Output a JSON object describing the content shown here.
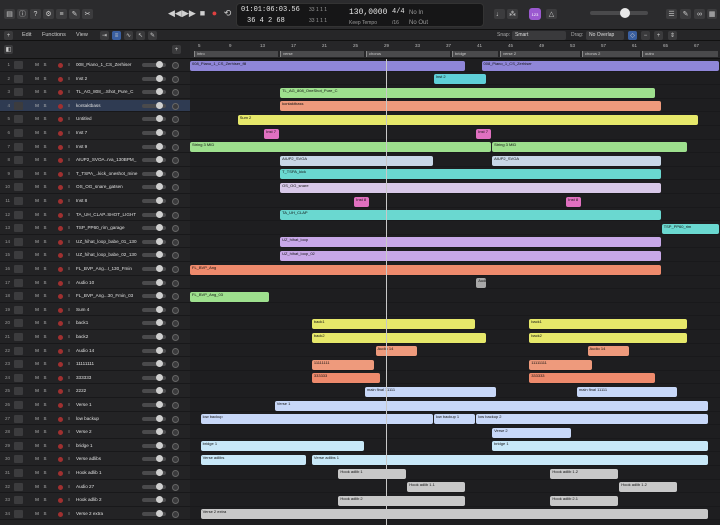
{
  "lcd": {
    "time": "01:01:06:03.56",
    "time_sub": "33 1 1   1",
    "bars": "36 4 2   68",
    "bars_sub": "33 1 1   1",
    "tempo": "130,0000",
    "tempo_sub": "Keep Tempo",
    "signature": "4/4",
    "signature_sub": "/16",
    "in": "No In",
    "out": "No Out"
  },
  "badge": "123",
  "toolbar": {
    "edit": "Edit",
    "functions": "Functions",
    "view": "View",
    "snap_label": "Snap:",
    "snap_value": "Smart",
    "drag_label": "Drag:",
    "drag_value": "No Overlap"
  },
  "ruler": {
    "bars": [
      "5",
      "9",
      "13",
      "17",
      "21",
      "25",
      "29",
      "33",
      "37",
      "41",
      "45",
      "49",
      "53",
      "57",
      "61",
      "65",
      "67"
    ],
    "markers": [
      "intro",
      "verse",
      "chorus",
      "verse 2",
      "bridge",
      "chorus 2",
      "outro"
    ]
  },
  "tracks": [
    {
      "num": "1",
      "name": "008_Piano_1_CS_Zerhiser"
    },
    {
      "num": "2",
      "name": "Inst 2"
    },
    {
      "num": "3",
      "name": "TL_AG_808_..Shot_Pure_C"
    },
    {
      "num": "4",
      "name": "kontaktbass"
    },
    {
      "num": "5",
      "name": "Untitled"
    },
    {
      "num": "6",
      "name": "Inst 7"
    },
    {
      "num": "7",
      "name": "Inst 9"
    },
    {
      "num": "8",
      "name": "AIUP2_SVOA..rva_130BPM_"
    },
    {
      "num": "9",
      "name": "T_TSPA_..kick_oneshot_mine"
    },
    {
      "num": "10",
      "name": "OS_OG_snare_gatsen"
    },
    {
      "num": "11",
      "name": "Inst 8"
    },
    {
      "num": "12",
      "name": "TA_UH_CLAP..SHOT_LIGHT"
    },
    {
      "num": "13",
      "name": "TSP_PP60_rim_garage"
    },
    {
      "num": "14",
      "name": "UZ_hihat_loop_babe_01_130"
    },
    {
      "num": "15",
      "name": "UZ_hihat_loop_babe_02_130"
    },
    {
      "num": "16",
      "name": "FL_BVP_Ang...I_130_Fmin"
    },
    {
      "num": "17",
      "name": "Audio 10"
    },
    {
      "num": "18",
      "name": "FL_BVP_Ang...30_Fmin_03"
    },
    {
      "num": "19",
      "name": "Sum 4"
    },
    {
      "num": "20",
      "name": "back1"
    },
    {
      "num": "21",
      "name": "back2"
    },
    {
      "num": "22",
      "name": "Audio 14"
    },
    {
      "num": "23",
      "name": "11111111"
    },
    {
      "num": "24",
      "name": "333333"
    },
    {
      "num": "25",
      "name": "2222"
    },
    {
      "num": "26",
      "name": "Verse 1"
    },
    {
      "num": "27",
      "name": "low backup"
    },
    {
      "num": "28",
      "name": "Verse 2"
    },
    {
      "num": "29",
      "name": "bridge 1"
    },
    {
      "num": "30",
      "name": "Verse adlibs"
    },
    {
      "num": "31",
      "name": "Hook adlib 1"
    },
    {
      "num": "32",
      "name": "Audio 27"
    },
    {
      "num": "33",
      "name": "Hook adlib 2"
    },
    {
      "num": "34",
      "name": "Verse 2 extra"
    }
  ],
  "regions": [
    {
      "lane": 0,
      "start": 0.0,
      "end": 0.52,
      "color": "#8f86d8",
      "label": "008_Piano_1_CS_Zerhiser_fill"
    },
    {
      "lane": 0,
      "start": 0.55,
      "end": 1.0,
      "color": "#8f86d8",
      "label": "008_Piano_1_CS_Zerhiser"
    },
    {
      "lane": 1,
      "start": 0.46,
      "end": 0.56,
      "color": "#5fd0d8",
      "label": "Inst 2"
    },
    {
      "lane": 1,
      "start": 0.56,
      "end": 0.56,
      "color": "#5fd0d8",
      "label": ""
    },
    {
      "lane": 2,
      "start": 0.17,
      "end": 0.88,
      "color": "#9ee08e",
      "label": "TL_AG_808_OneShot_Pure_C"
    },
    {
      "lane": 3,
      "start": 0.17,
      "end": 0.89,
      "color": "#ee9a7c",
      "label": "kontaktbass"
    },
    {
      "lane": 4,
      "start": 0.09,
      "end": 0.96,
      "color": "#e6e86a",
      "label": "Sum 2"
    },
    {
      "lane": 5,
      "start": 0.14,
      "end": 0.17,
      "color": "#e070c0",
      "label": "Inst 7"
    },
    {
      "lane": 5,
      "start": 0.54,
      "end": 0.57,
      "color": "#e070c0",
      "label": "Inst 7"
    },
    {
      "lane": 6,
      "start": 0.0,
      "end": 0.57,
      "color": "#9ee08e",
      "label": "String 3 MID"
    },
    {
      "lane": 6,
      "start": 0.57,
      "end": 0.94,
      "color": "#9ee08e",
      "label": "String 3 MID"
    },
    {
      "lane": 7,
      "start": 0.17,
      "end": 0.46,
      "color": "#c8d8e8",
      "label": "AIUP2_SVOA"
    },
    {
      "lane": 7,
      "start": 0.57,
      "end": 0.89,
      "color": "#c8d8e8",
      "label": "AIUP2_SVOA"
    },
    {
      "lane": 8,
      "start": 0.17,
      "end": 0.89,
      "color": "#6ad8d0",
      "label": "T_TSPA_kick"
    },
    {
      "lane": 9,
      "start": 0.17,
      "end": 0.89,
      "color": "#d8c8e8",
      "label": "OS_OG_snare"
    },
    {
      "lane": 10,
      "start": 0.31,
      "end": 0.34,
      "color": "#e070c0",
      "label": "Inst 8"
    },
    {
      "lane": 10,
      "start": 0.71,
      "end": 0.74,
      "color": "#e070c0",
      "label": "Inst 8"
    },
    {
      "lane": 11,
      "start": 0.17,
      "end": 0.89,
      "color": "#6ad8d0",
      "label": "TA_UH_CLAP"
    },
    {
      "lane": 12,
      "start": 0.89,
      "end": 1.0,
      "color": "#6ad8d0",
      "label": "TSP_PP60_rim"
    },
    {
      "lane": 13,
      "start": 0.17,
      "end": 0.89,
      "color": "#c8a8e8",
      "label": "UZ_hihat_loop"
    },
    {
      "lane": 14,
      "start": 0.17,
      "end": 0.89,
      "color": "#c8a8e8",
      "label": "UZ_hihat_loop_02"
    },
    {
      "lane": 15,
      "start": 0.0,
      "end": 0.89,
      "color": "#ee8a6c",
      "label": "FL_BVP_Ang"
    },
    {
      "lane": 16,
      "start": 0.54,
      "end": 0.56,
      "color": "#a8a8a8",
      "label": "Audio 10"
    },
    {
      "lane": 17,
      "start": 0.0,
      "end": 0.15,
      "color": "#9ee08e",
      "label": "FL_BVP_Ang_03"
    },
    {
      "lane": 19,
      "start": 0.23,
      "end": 0.54,
      "color": "#e6e86a",
      "label": "back1"
    },
    {
      "lane": 19,
      "start": 0.64,
      "end": 0.94,
      "color": "#e6e86a",
      "label": "back1"
    },
    {
      "lane": 20,
      "start": 0.23,
      "end": 0.56,
      "color": "#e6e86a",
      "label": "back2"
    },
    {
      "lane": 20,
      "start": 0.64,
      "end": 0.94,
      "color": "#e6e86a",
      "label": "back2"
    },
    {
      "lane": 21,
      "start": 0.35,
      "end": 0.43,
      "color": "#ee9a7c",
      "label": "Audio 14"
    },
    {
      "lane": 21,
      "start": 0.75,
      "end": 0.83,
      "color": "#ee9a7c",
      "label": "Audio 14"
    },
    {
      "lane": 22,
      "start": 0.23,
      "end": 0.35,
      "color": "#ee9a7c",
      "label": "11111111"
    },
    {
      "lane": 22,
      "start": 0.64,
      "end": 0.76,
      "color": "#ee9a7c",
      "label": "11111111"
    },
    {
      "lane": 23,
      "start": 0.23,
      "end": 0.36,
      "color": "#ee8a6c",
      "label": "333333"
    },
    {
      "lane": 23,
      "start": 0.64,
      "end": 0.88,
      "color": "#ee8a6c",
      "label": "333333"
    },
    {
      "lane": 24,
      "start": 0.33,
      "end": 0.58,
      "color": "#c8d8f8",
      "label": "main final 11111"
    },
    {
      "lane": 24,
      "start": 0.73,
      "end": 0.92,
      "color": "#c8d8f8",
      "label": "main final 11111"
    },
    {
      "lane": 25,
      "start": 0.16,
      "end": 0.98,
      "color": "#c8d8f8",
      "label": "Verse 1"
    },
    {
      "lane": 26,
      "start": 0.02,
      "end": 0.46,
      "color": "#c8d8f8",
      "label": "low backup"
    },
    {
      "lane": 26,
      "start": 0.46,
      "end": 0.54,
      "color": "#c8d8f8",
      "label": "low backup 1"
    },
    {
      "lane": 26,
      "start": 0.54,
      "end": 0.98,
      "color": "#c8d8f8",
      "label": "low backup 2"
    },
    {
      "lane": 27,
      "start": 0.57,
      "end": 0.72,
      "color": "#c8d8f8",
      "label": "Verse 2"
    },
    {
      "lane": 28,
      "start": 0.02,
      "end": 0.33,
      "color": "#c8e8f8",
      "label": "bridge 1"
    },
    {
      "lane": 28,
      "start": 0.57,
      "end": 0.98,
      "color": "#c8e8f8",
      "label": "bridge 1"
    },
    {
      "lane": 29,
      "start": 0.02,
      "end": 0.22,
      "color": "#c8e8f8",
      "label": "Verse adlibs"
    },
    {
      "lane": 29,
      "start": 0.23,
      "end": 0.98,
      "color": "#c8e8f8",
      "label": "Verse adlibs 1"
    },
    {
      "lane": 30,
      "start": 0.28,
      "end": 0.41,
      "color": "#c8c8c8",
      "label": "Hook adlib 1"
    },
    {
      "lane": 30,
      "start": 0.68,
      "end": 0.81,
      "color": "#c8c8c8",
      "label": "Hook adlib 1.2"
    },
    {
      "lane": 31,
      "start": 0.41,
      "end": 0.52,
      "color": "#c8c8c8",
      "label": "Hook adlib 1.1"
    },
    {
      "lane": 31,
      "start": 0.81,
      "end": 0.92,
      "color": "#c8c8c8",
      "label": "Hook adlib 1.2"
    },
    {
      "lane": 32,
      "start": 0.28,
      "end": 0.52,
      "color": "#c8c8c8",
      "label": "Hook adlib 2"
    },
    {
      "lane": 32,
      "start": 0.68,
      "end": 0.81,
      "color": "#c8c8c8",
      "label": "Hook adlib 2.1"
    },
    {
      "lane": 33,
      "start": 0.02,
      "end": 0.98,
      "color": "#c8c8c8",
      "label": "Verse 2 extra"
    }
  ]
}
